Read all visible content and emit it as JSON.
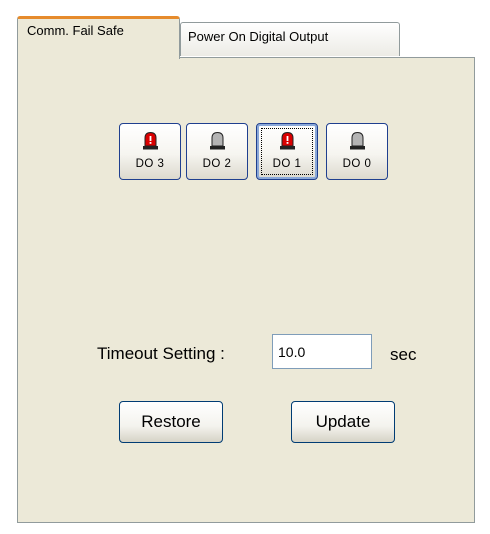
{
  "tabs": [
    {
      "label": "Comm. Fail Safe",
      "active": true
    },
    {
      "label": "Power On Digital Output",
      "active": false
    }
  ],
  "outputs": [
    {
      "label": "DO 3",
      "state": "on"
    },
    {
      "label": "DO 2",
      "state": "off"
    },
    {
      "label": "DO 1",
      "state": "on",
      "focused": true
    },
    {
      "label": "DO 0",
      "state": "off"
    }
  ],
  "timeout": {
    "label": "Timeout Setting :",
    "value": "10.0",
    "unit": "sec"
  },
  "buttons": {
    "restore": "Restore",
    "update": "Update"
  },
  "colors": {
    "lamp_on": "#d90000",
    "lamp_off": "#b4b4b4",
    "tab_accent": "#e68b2c",
    "panel_bg": "#ece9d8"
  }
}
